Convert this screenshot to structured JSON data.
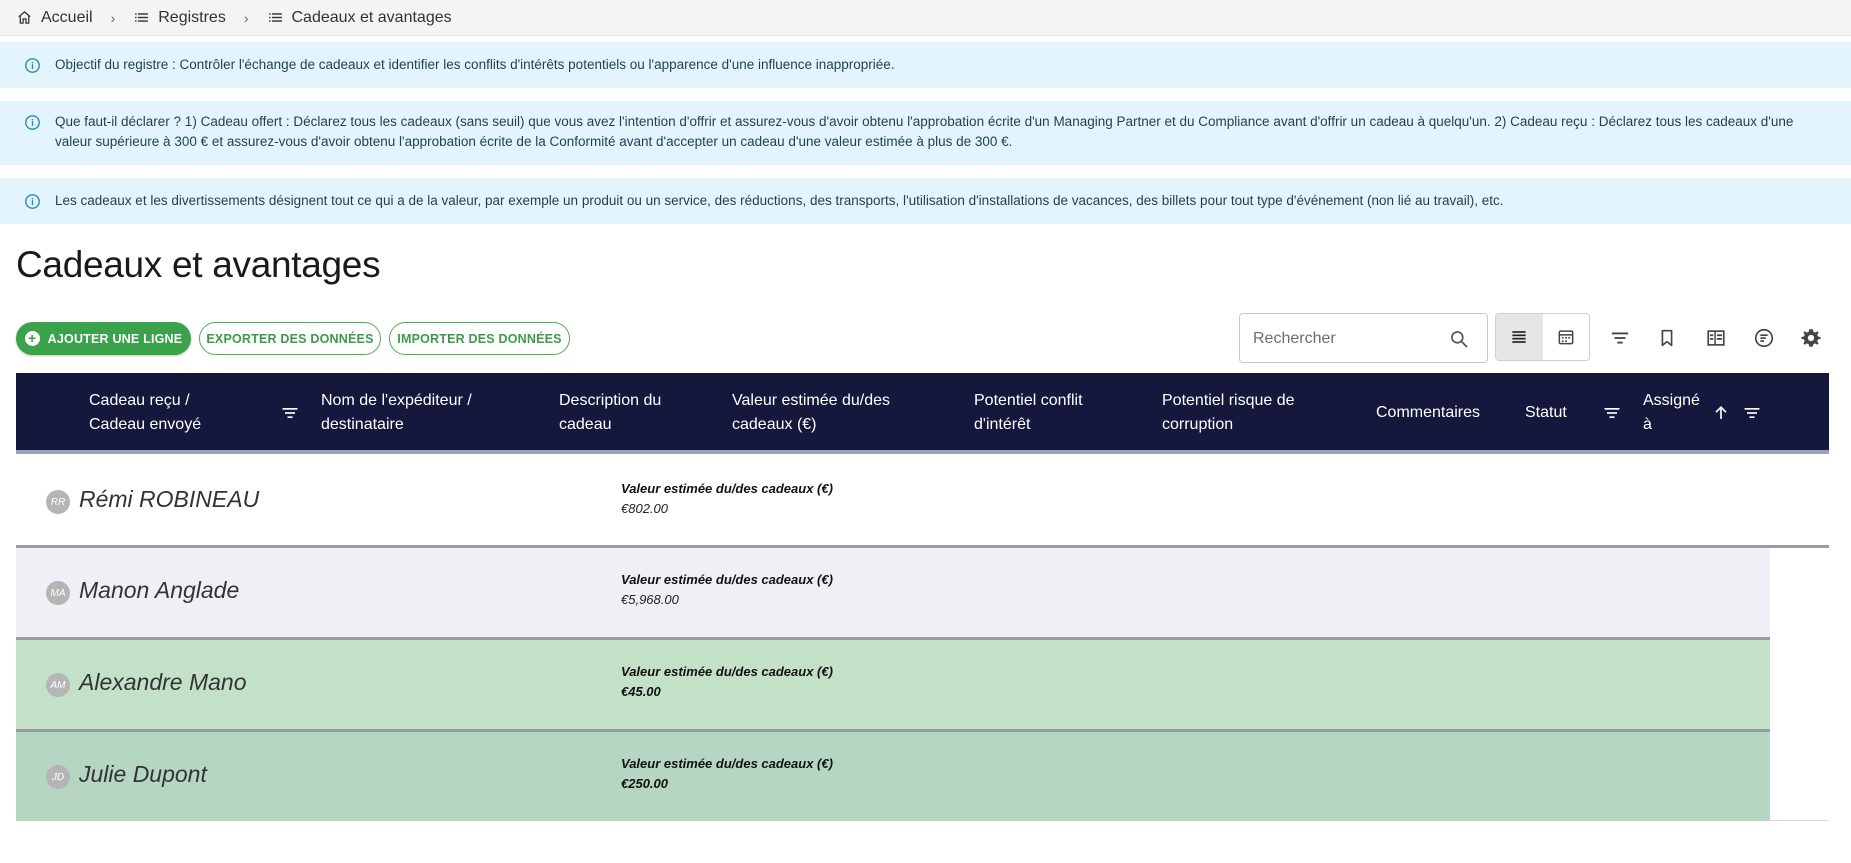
{
  "breadcrumb": {
    "home": "Accueil",
    "registers": "Registres",
    "current": "Cadeaux et avantages"
  },
  "banners": [
    "Objectif du registre : Contrôler l'échange de cadeaux et identifier les conflits d'intérêts potentiels ou l'apparence d'une influence inappropriée.",
    "Que faut-il déclarer ? 1) Cadeau offert : Déclarez tous les cadeaux (sans seuil) que vous avez l'intention d'offrir et assurez-vous d'avoir obtenu l'approbation écrite d'un Managing Partner et du Compliance avant d'offrir un cadeau à quelqu'un. 2) Cadeau reçu : Déclarez tous les cadeaux d'une valeur supérieure à 300 € et assurez-vous d'avoir obtenu l'approbation écrite de la Conformité avant d'accepter un cadeau d'une valeur estimée à plus de 300 €.",
    "Les cadeaux et les divertissements désignent tout ce qui a de la valeur, par exemple un produit ou un service, des réductions, des transports, l'utilisation d'installations de vacances, des billets pour tout type d'événement (non lié au travail), etc."
  ],
  "page_title": "Cadeaux et avantages",
  "actions": {
    "add": "AJOUTER UNE LIGNE",
    "export": "EXPORTER DES DONNÉES",
    "import": "IMPORTER DES DONNÉES"
  },
  "search": {
    "placeholder": "Rechercher",
    "value": ""
  },
  "columns": [
    "Cadeau reçu / Cadeau envoyé",
    "Nom de l'expéditeur / destinataire",
    "Description du cadeau",
    "Valeur estimée du/des cadeaux (€)",
    "Potentiel conflit d'intérêt",
    "Potentiel risque de corruption",
    "Commentaires",
    "Statut",
    "Assigné à"
  ],
  "column_lines": {
    "c0": [
      "Cadeau reçu /",
      "Cadeau envoyé"
    ],
    "c1": [
      "Nom de l'expéditeur /",
      "destinataire"
    ],
    "c2": [
      "Description du",
      "cadeau"
    ],
    "c3": [
      "Valeur estimée du/des",
      "cadeaux (€)"
    ],
    "c4": [
      "Potentiel conflit",
      "d'intérêt"
    ],
    "c5": [
      "Potentiel risque de",
      "corruption"
    ],
    "c6": [
      "Commentaires"
    ],
    "c7": [
      "Statut"
    ],
    "c8": [
      "Assigné",
      "à"
    ]
  },
  "groups": [
    {
      "initials": "RR",
      "name": "Rémi ROBINEAU",
      "value_label": "Valeur estimée du/des cadeaux (€)",
      "value": "€802.00",
      "color": "#ffffff"
    },
    {
      "initials": "MA",
      "name": "Manon Anglade",
      "value_label": "Valeur estimée du/des cadeaux (€)",
      "value": "€5,968.00",
      "color": "#eef0f5"
    },
    {
      "initials": "AM",
      "name": "Alexandre Mano",
      "value_label": "Valeur estimée du/des cadeaux (€)",
      "value": "€45.00",
      "color": "#c3e1c7"
    },
    {
      "initials": "JD",
      "name": "Julie Dupont",
      "value_label": "Valeur estimée du/des cadeaux (€)",
      "value": "€250.00",
      "color": "#b6d6c4"
    }
  ],
  "icons": {
    "home": "home-icon",
    "list": "list-icon",
    "info": "info-icon",
    "search": "search-icon",
    "filter": "filter-icon",
    "bookmark": "bookmark-icon",
    "settings": "gear-icon",
    "sort": "arrow-up-icon"
  },
  "colors": {
    "header_bg": "#15173d",
    "accent_green": "#3aa24a",
    "info_bg": "#e4f4fc"
  }
}
